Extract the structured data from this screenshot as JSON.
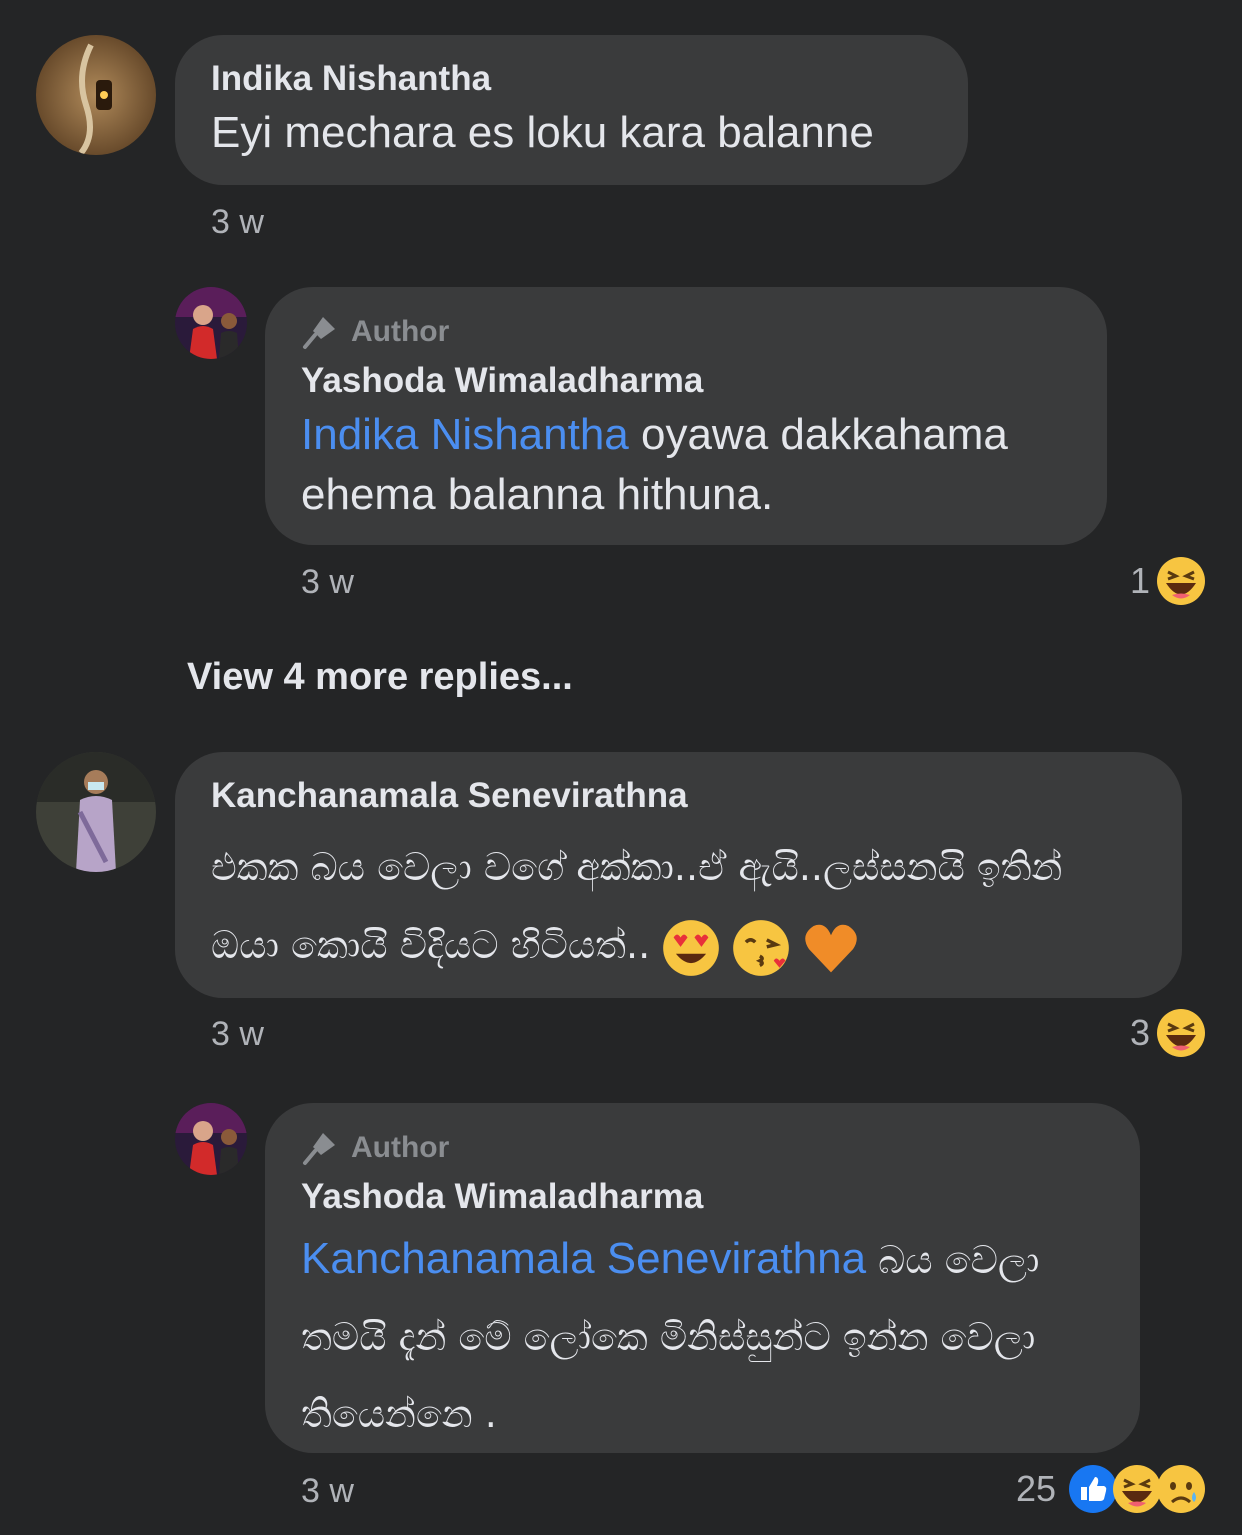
{
  "comments": [
    {
      "author": "Indika Nishantha",
      "text": "Eyi mechara es loku kara balanne",
      "time": "3 w",
      "reply": {
        "badge": "Author",
        "author": "Yashoda Wimaladharma",
        "mention": "Indika Nishantha",
        "text_line1": " oyawa dakkahama",
        "text_line2": "ehema balanna hithuna.",
        "time": "3 w",
        "reaction_count": "1"
      }
    },
    {
      "author": "Kanchanamala Senevirathna",
      "text_line1": "එකක බය වෙලා වගේ අක්කා..ඒ ඇයි..ලස්සනයි ඉතින්",
      "text_line2": "ඔයා කොයි විදියට හිටියත්..",
      "time": "3 w",
      "reaction_count": "3",
      "reply": {
        "badge": "Author",
        "author": "Yashoda Wimaladharma",
        "mention": "Kanchanamala Senevirathna",
        "text_line1": " බය වෙලා",
        "text_line2": "තමයි දැන් මේ ලෝකෙ මිනිස්සුන්ට ඉන්න වෙලා",
        "text_line3": "තියෙන්නෙ .",
        "time": "3 w",
        "reaction_count": "25"
      }
    }
  ],
  "view_more": "View 4 more replies..."
}
